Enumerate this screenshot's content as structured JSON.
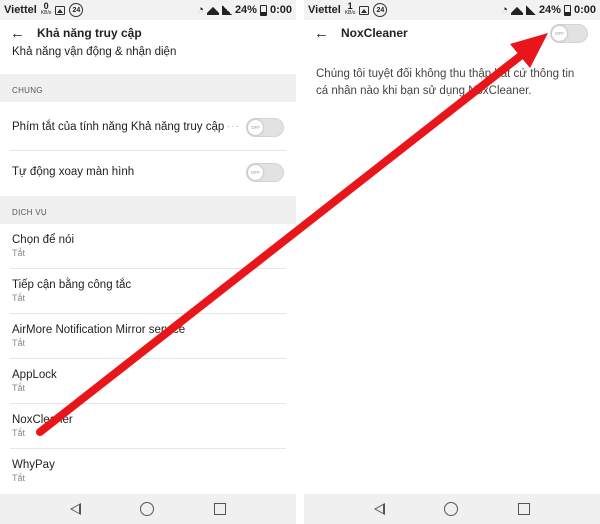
{
  "status_left": {
    "carrier": "Viettel",
    "speed_value": "0",
    "speed_unit": "KB/s",
    "badge": "24",
    "battery": "24%",
    "time": "0:00"
  },
  "status_right": {
    "carrier": "Viettel",
    "speed_value": "1",
    "speed_unit": "KB/s",
    "badge": "24",
    "battery": "24%",
    "time": "0:00"
  },
  "left": {
    "title": "Khả năng truy cập",
    "top_item": "Khả năng vận động & nhận diện",
    "section_general": "CHUNG",
    "shortcut": {
      "label": "Phím tắt của tính năng Khả năng truy cập",
      "more": "···",
      "toggle_text": "OFF"
    },
    "auto_rotate": {
      "label": "Tự động xoay màn hình",
      "toggle_text": "OFF"
    },
    "section_services": "DỊCH VỤ",
    "services": [
      {
        "name": "Chọn để nói",
        "status": "Tắt"
      },
      {
        "name": "Tiếp cận bằng công tắc",
        "status": "Tắt"
      },
      {
        "name": "AirMore Notification Mirror service",
        "status": "Tắt"
      },
      {
        "name": "AppLock",
        "status": "Tắt"
      },
      {
        "name": "NoxCleaner",
        "status": "Tắt"
      },
      {
        "name": "WhyPay",
        "status": "Tắt"
      }
    ]
  },
  "right": {
    "title": "NoxCleaner",
    "toggle_text": "OFF",
    "description": "Chúng tôi tuyệt đối không thu thập bất cứ thông tin cá nhân nào khi bạn sử dụng NoxCleaner."
  },
  "colors": {
    "arrow": "#e8161b",
    "section_bg": "#f0f0f0",
    "toggle_off": "#e2e2e2"
  }
}
